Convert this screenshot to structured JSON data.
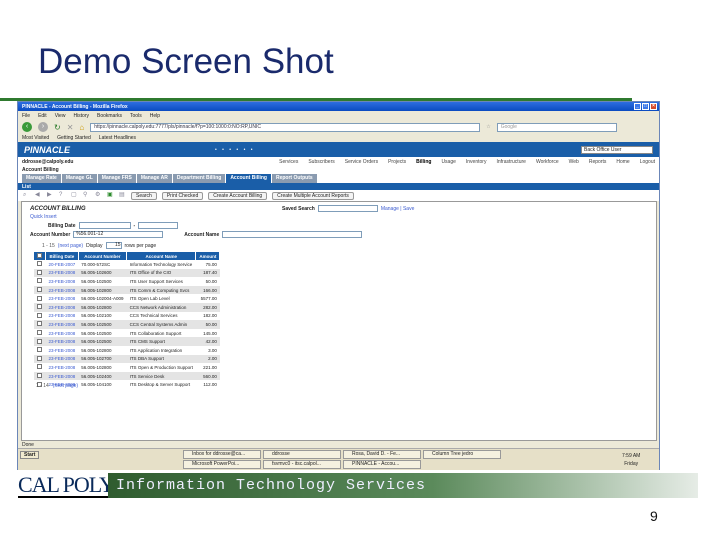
{
  "slide": {
    "title": "Demo Screen Shot",
    "page_number": "9",
    "footer_logo": "CAL POLY",
    "footer_banner": "Information Technology Services"
  },
  "browser": {
    "window_title": "PINNACLE - Account Billing - Mozilla Firefox",
    "menu": [
      "File",
      "Edit",
      "View",
      "History",
      "Bookmarks",
      "Tools",
      "Help"
    ],
    "url": "https://pinnacle.calpoly.edu:7777/pls/pinnacle/f?p=100:1000:0:NO:RP,UNIC",
    "search_placeholder": "Google",
    "bookmarks": [
      "Most Visited",
      "Getting Started",
      "Latest Headlines"
    ],
    "status": "Done"
  },
  "app": {
    "logo": "PINNACLE",
    "dots": "• • • • • •",
    "role": "Back Office User",
    "user": "ddrosse@calpoly.edu",
    "top_links": [
      "Services",
      "Subscribers",
      "Service Orders",
      "Projects",
      "Billing",
      "Usage",
      "Inventory",
      "Infrastructure",
      "Workforce",
      "Web",
      "Reports",
      "Home",
      "Logout"
    ],
    "active_top_link": "Billing",
    "section": "Account Billing",
    "tabs": [
      "Manage Rate",
      "Manage GL",
      "Manage FRS",
      "Manage AR",
      "Department Billing",
      "Account Billing",
      "Report Outputs"
    ],
    "active_tab": "Account Billing",
    "list_label": "List",
    "toolbar_buttons": [
      "Search",
      "Print Checked",
      "Create Account Billing",
      "Create Multiple Account Reports"
    ]
  },
  "panel": {
    "title": "ACCOUNT BILLING",
    "saved_search_label": "Saved Search",
    "saved_search_links": "Manage | Save",
    "quick_insert": "Quick Insert",
    "billing_date_label": "Billing Date",
    "account_number_label": "Account Number",
    "account_number_value": "%56.001-12",
    "account_name_label": "Account Name",
    "display_label": "Display",
    "rows_per_page": "15",
    "rows_per_page_suffix": "rows per page",
    "pager_prefix": "1 - 15",
    "pager_link": "(next page)",
    "columns": [
      "Billing Date",
      "Account Number",
      "Account Name",
      "Amount"
    ],
    "rows": [
      [
        "20-FEB-2007",
        "70.000-572SC",
        "Information Technology Service",
        "75.00"
      ],
      [
        "23-FEB-2008",
        "56.005-102600",
        "ITS Office of the CIO",
        "187.40"
      ],
      [
        "23-FEB-2008",
        "56.005-102500",
        "ITS User Support Services",
        "50.00"
      ],
      [
        "23-FEB-2008",
        "56.005-102800",
        "ITS Comm & Computing Svcs",
        "166.00"
      ],
      [
        "23-FEB-2008",
        "56.005-102004-A009",
        "ITS Open Lab Level",
        "5577.00"
      ],
      [
        "23-FEB-2008",
        "56.005-102800",
        "CCS Network Administration",
        "282.00"
      ],
      [
        "23-FEB-2008",
        "56.005-102100",
        "CCS Technical Services",
        "182.00"
      ],
      [
        "23-FEB-2008",
        "56.005-102500",
        "CCS Central Systems Admin",
        "50.00"
      ],
      [
        "23-FEB-2008",
        "56.005-102500",
        "ITS Collaboration Support",
        "145.00"
      ],
      [
        "23-FEB-2008",
        "56.005-102500",
        "ITS CMS Support",
        "42.00"
      ],
      [
        "23-FEB-2008",
        "56.005-102800",
        "ITS Application Integration",
        "3.00"
      ],
      [
        "23-FEB-2008",
        "56.005-102700",
        "ITS DBA Support",
        "2.00"
      ],
      [
        "23-FEB-2008",
        "56.005-102800",
        "ITS Open & Production Support",
        "221.00"
      ],
      [
        "23-FEB-2008",
        "56.005-102400",
        "ITS Service Desk",
        "560.00"
      ],
      [
        "23-FEB-2008",
        "56.005-104100",
        "ITS Desktop & Server Support",
        "112.00"
      ]
    ],
    "footer": "1 - 14",
    "footer_link": "(next page)"
  },
  "taskbar": {
    "start": "Start",
    "tasks": [
      "Inbox for ddrosse@ca...",
      "ddrosse",
      "Rosa, David D. - Fe...",
      "Column Tree jedro",
      "Microsoft PowerPoi...",
      "fsvmvc0 - itsc.calpol...",
      "PINNACLE - Accou..."
    ],
    "time": "7:59 AM",
    "day": "Friday"
  }
}
